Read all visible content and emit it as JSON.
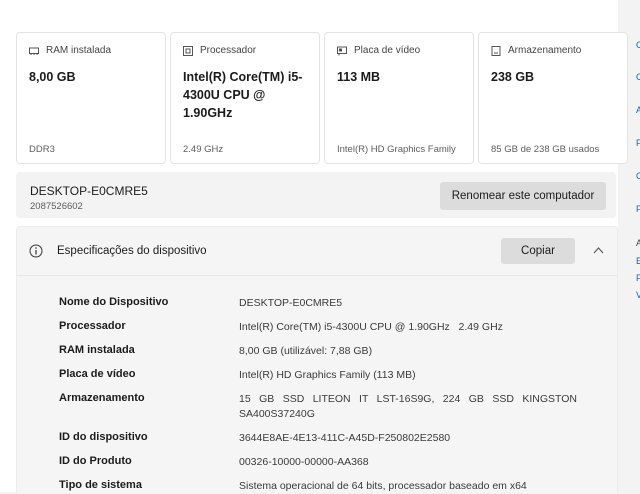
{
  "cards": [
    {
      "label": "RAM instalada",
      "value": "8,00 GB",
      "sub": "DDR3",
      "icon": "ram-icon"
    },
    {
      "label": "Processador",
      "value": "Intel(R) Core(TM) i5-4300U CPU @ 1.90GHz",
      "sub": "2.49 GHz",
      "icon": "processor-icon"
    },
    {
      "label": "Placa de vídeo",
      "value": "113 MB",
      "sub": "Intel(R) HD Graphics Family",
      "icon": "gpu-icon"
    },
    {
      "label": "Armazenamento",
      "value": "238 GB",
      "sub": "85 GB de 238 GB usados",
      "icon": "storage-icon"
    }
  ],
  "pc": {
    "name": "DESKTOP-E0CMRE5",
    "id": "2087526602",
    "rename_label": "Renomear este computador"
  },
  "specs": {
    "title": "Especificações do dispositivo",
    "copy_label": "Copiar",
    "rows": [
      {
        "label": "Nome do Dispositivo",
        "value": "DESKTOP-E0CMRE5"
      },
      {
        "label": "Processador",
        "value": "Intel(R) Core(TM) i5-4300U CPU @ 1.90GHz   2.49 GHz"
      },
      {
        "label": "RAM instalada",
        "value": "8,00 GB (utilizável: 7,88 GB)"
      },
      {
        "label": "Placa de vídeo",
        "value": "Intel(R) HD Graphics Family (113 MB)"
      },
      {
        "label": "Armazenamento",
        "value": "15 GB SSD LITEON IT LST-16S9G, 224 GB SSD KINGSTON SA400S37240G"
      },
      {
        "label": "ID do dispositivo",
        "value": "3644E8AE-4E13-411C-A45D-F250802E2580"
      },
      {
        "label": "ID do Produto",
        "value": "00326-10000-00000-AA368"
      },
      {
        "label": "Tipo de sistema",
        "value": "Sistema operacional de 64 bits, processador baseado em x64"
      }
    ]
  },
  "right_panel": {
    "links": [
      "C",
      "C",
      "A",
      "F",
      "C",
      "F"
    ],
    "texts": [
      "A",
      "E",
      "F",
      "V"
    ]
  },
  "colors": {
    "accent": "#0067c0",
    "button": "#dcdcdc"
  }
}
